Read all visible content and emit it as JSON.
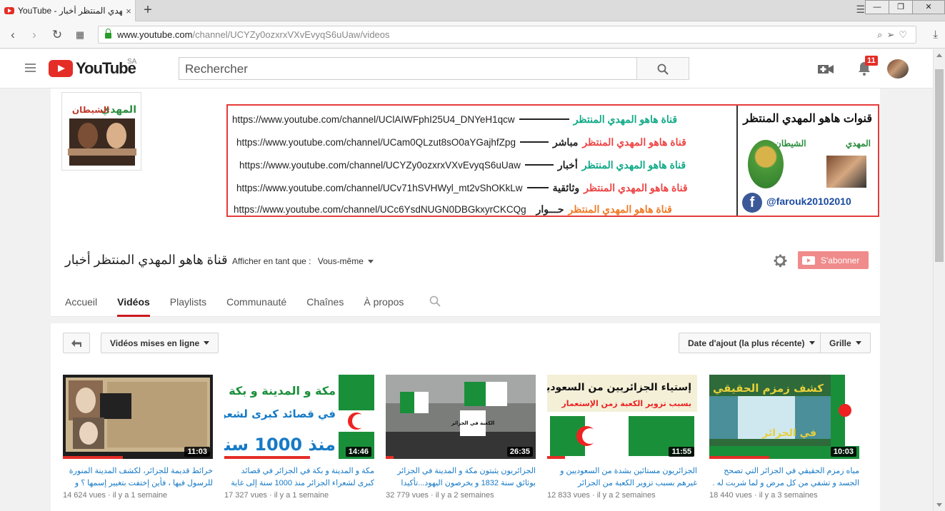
{
  "browser": {
    "tab_title": "YouTube - المهدي المنتظر أخبار",
    "tab_close": "×",
    "newtab": "+",
    "url_host": "www.youtube.com",
    "url_path": "/channel/UCYZy0ozxrxVXvEvyqS6uUaw/videos"
  },
  "header": {
    "logo_text": "YouTube",
    "country": "SA",
    "search_placeholder": "Rechercher",
    "notif_count": "11"
  },
  "banner": {
    "rows": [
      {
        "url": "https://www.youtube.com/channel/UClAIWFphI25U4_DNYeH1qcw",
        "label": "",
        "name": "قناة هاهو المهدي المنتظر"
      },
      {
        "url": "https://www.youtube.com/channel/UCam0QLzut8sO0aYGajhfZpg",
        "label": "مباشر",
        "name": "قناة هاهو المهدي المنتظر"
      },
      {
        "url": "https://www.youtube.com/channel/UCYZy0ozxrxVXvEvyqS6uUaw",
        "label": "أخبار",
        "name": "قناة هاهو المهدي المنتظر"
      },
      {
        "url": "https://www.youtube.com/channel/UCv71hSVHWyl_mt2vShOKkLw",
        "label": "وثائقية",
        "name": "قناة هاهو المهدي المنتظر"
      },
      {
        "url": "https://www.youtube.com/channel/UCc6YsdNUGN0DBGkxyrCKCQg",
        "label": "حـــوار",
        "name": "قناة هاهو المهدي المنتظر"
      }
    ],
    "side_title": "قنوات هاهو المهدي المنتظر",
    "side_label1": "المهدي",
    "side_label2": "الشيطان",
    "fb_handle": "@farouk20102010",
    "fb_letter": "f"
  },
  "channel": {
    "avatar_label1": "المهدي",
    "avatar_label2": "الشيطان",
    "title": "قناة هاهو المهدي المنتظر أخبار",
    "view_as_label": "Afficher en tant que :",
    "view_as_value": "Vous-même",
    "subscribe_label": "S'abonner",
    "tabs": [
      "Accueil",
      "Vidéos",
      "Playlists",
      "Communauté",
      "Chaînes",
      "À propos"
    ]
  },
  "videos_toolbar": {
    "filter_label": "Vidéos mises en ligne",
    "sort_label": "Date d'ajout (la plus récente)",
    "view_label": "Grille"
  },
  "videos": [
    {
      "title": "خرائط قديمة للجزائر، لكشف المدينة المنورة للرسول فيها ، فأين إختفت بتغيير إسمها ؟ و",
      "duration": "11:03",
      "views": "14 624 vues",
      "age": "il y a 1 semaine",
      "progress": 0.4
    },
    {
      "title": "مكة و المدينة و بكة في الجزائر في قصائد كبرى لشعراء الجزائر منذ 1000 سنة إلى غاية سنة",
      "duration": "14:46",
      "views": "17 327 vues",
      "age": "il y a 1 semaine",
      "progress": 0.57
    },
    {
      "title": "الجزائريون يثبتون مكة و المدينة في الجزائر بوثائق سنة 1832 و يخرصون اليهود...تأكيدا",
      "duration": "26:35",
      "views": "32 779 vues",
      "age": "il y a 2 semaines",
      "progress": 0.05
    },
    {
      "title": "الجزائريون مستائين بشدة من السعوديين و غيرهم بسبب تزوير الكعبة من الجزائر للسعودية",
      "duration": "11:55",
      "views": "12 833 vues",
      "age": "il y a 2 semaines",
      "progress": 0.12
    },
    {
      "title": "مياه زمزم الحقيقي في الجزائر التي تصحح الجسد و تشفي من كل مرض و لما شربت له .",
      "duration": "10:03",
      "views": "18 440 vues",
      "age": "il y a 3 semaines",
      "progress": 0.4
    }
  ],
  "thumb_text": {
    "v2_line1": "مكة و المدينة و بكة في الجزائر",
    "v2_line2": "في قصائد كبرى لشعراء الجزائر",
    "v2_line3": "منذ 1000 سنة",
    "v3_sign": "الكعبة في الجزائر",
    "v4_line1": "إستياء الجزائريين من السعوديين",
    "v4_line2": "بسبب تزوير الكعبة زمن الإستعمار",
    "v5_line1": "كشف زمزم الحقيقي",
    "v5_line2": "في الجزائر"
  },
  "colors": {
    "accent": "#e52d27",
    "link": "#167ac6",
    "subscribe": "#f08b8b"
  }
}
